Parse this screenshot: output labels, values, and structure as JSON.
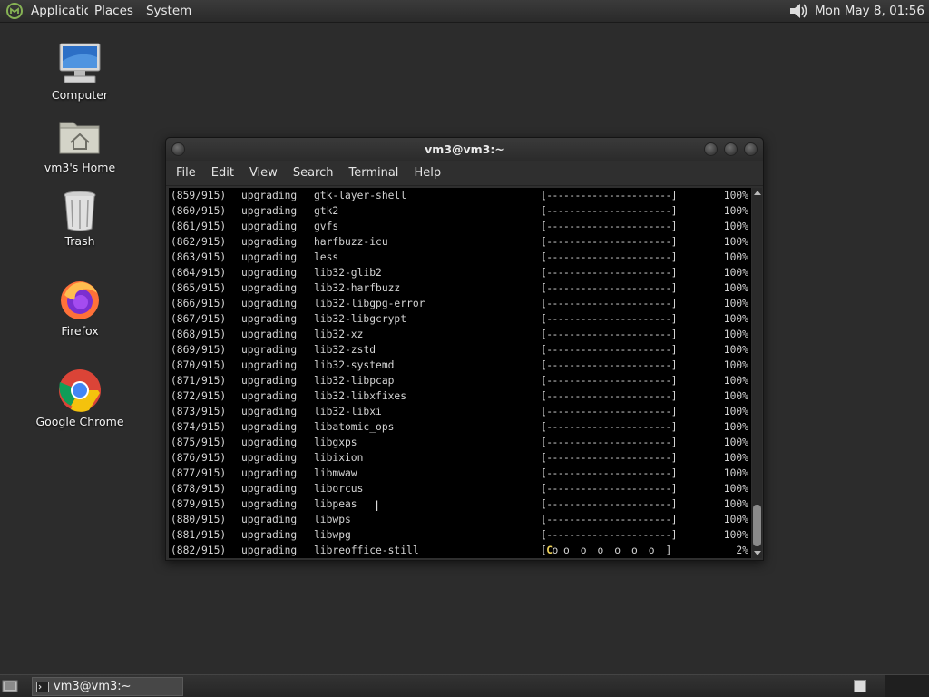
{
  "top_panel": {
    "menus": [
      "Applications",
      "Places",
      "System"
    ],
    "clock": "Mon May  8, 01:56"
  },
  "desktop_icons": [
    {
      "label": "Computer",
      "icon": "computer-icon"
    },
    {
      "label": "vm3's Home",
      "icon": "home-folder-icon"
    },
    {
      "label": "Trash",
      "icon": "trash-icon"
    },
    {
      "label": "Firefox",
      "icon": "firefox-icon"
    },
    {
      "label": "Google Chrome",
      "icon": "chrome-icon"
    }
  ],
  "terminal": {
    "title": "vm3@vm3:~",
    "menus": [
      "File",
      "Edit",
      "View",
      "Search",
      "Terminal",
      "Help"
    ],
    "lines": [
      {
        "index": "(859/915)",
        "action": "upgrading",
        "package": "gtk-layer-shell",
        "bar": "[----------------------]",
        "percent": "100%"
      },
      {
        "index": "(860/915)",
        "action": "upgrading",
        "package": "gtk2",
        "bar": "[----------------------]",
        "percent": "100%"
      },
      {
        "index": "(861/915)",
        "action": "upgrading",
        "package": "gvfs",
        "bar": "[----------------------]",
        "percent": "100%"
      },
      {
        "index": "(862/915)",
        "action": "upgrading",
        "package": "harfbuzz-icu",
        "bar": "[----------------------]",
        "percent": "100%"
      },
      {
        "index": "(863/915)",
        "action": "upgrading",
        "package": "less",
        "bar": "[----------------------]",
        "percent": "100%"
      },
      {
        "index": "(864/915)",
        "action": "upgrading",
        "package": "lib32-glib2",
        "bar": "[----------------------]",
        "percent": "100%"
      },
      {
        "index": "(865/915)",
        "action": "upgrading",
        "package": "lib32-harfbuzz",
        "bar": "[----------------------]",
        "percent": "100%"
      },
      {
        "index": "(866/915)",
        "action": "upgrading",
        "package": "lib32-libgpg-error",
        "bar": "[----------------------]",
        "percent": "100%"
      },
      {
        "index": "(867/915)",
        "action": "upgrading",
        "package": "lib32-libgcrypt",
        "bar": "[----------------------]",
        "percent": "100%"
      },
      {
        "index": "(868/915)",
        "action": "upgrading",
        "package": "lib32-xz",
        "bar": "[----------------------]",
        "percent": "100%"
      },
      {
        "index": "(869/915)",
        "action": "upgrading",
        "package": "lib32-zstd",
        "bar": "[----------------------]",
        "percent": "100%"
      },
      {
        "index": "(870/915)",
        "action": "upgrading",
        "package": "lib32-systemd",
        "bar": "[----------------------]",
        "percent": "100%"
      },
      {
        "index": "(871/915)",
        "action": "upgrading",
        "package": "lib32-libpcap",
        "bar": "[----------------------]",
        "percent": "100%"
      },
      {
        "index": "(872/915)",
        "action": "upgrading",
        "package": "lib32-libxfixes",
        "bar": "[----------------------]",
        "percent": "100%"
      },
      {
        "index": "(873/915)",
        "action": "upgrading",
        "package": "lib32-libxi",
        "bar": "[----------------------]",
        "percent": "100%"
      },
      {
        "index": "(874/915)",
        "action": "upgrading",
        "package": "libatomic_ops",
        "bar": "[----------------------]",
        "percent": "100%"
      },
      {
        "index": "(875/915)",
        "action": "upgrading",
        "package": "libgxps",
        "bar": "[----------------------]",
        "percent": "100%"
      },
      {
        "index": "(876/915)",
        "action": "upgrading",
        "package": "libixion",
        "bar": "[----------------------]",
        "percent": "100%"
      },
      {
        "index": "(877/915)",
        "action": "upgrading",
        "package": "libmwaw",
        "bar": "[----------------------]",
        "percent": "100%"
      },
      {
        "index": "(878/915)",
        "action": "upgrading",
        "package": "liborcus",
        "bar": "[----------------------]",
        "percent": "100%"
      },
      {
        "index": "(879/915)",
        "action": "upgrading",
        "package": "libpeas",
        "bar": "[----------------------]",
        "percent": "100%"
      },
      {
        "index": "(880/915)",
        "action": "upgrading",
        "package": "libwps",
        "bar": "[----------------------]",
        "percent": "100%"
      },
      {
        "index": "(881/915)",
        "action": "upgrading",
        "package": "libwpg",
        "bar": "[----------------------]",
        "percent": "100%"
      },
      {
        "index": "(882/915)",
        "action": "upgrading",
        "package": "libreoffice-still",
        "bar_open": "[",
        "bar_pacman": "C",
        "bar_rest": "o o  o  o  o  o  o  ]",
        "percent": "2%"
      }
    ],
    "scroll_position": 0.92
  },
  "taskbar": {
    "task_label": "vm3@vm3:~"
  },
  "colors": {
    "desktop": "#2c2c2c",
    "terminal_bg": "#000000",
    "terminal_fg": "#d4d4d4",
    "pacman": "#f0d35a"
  }
}
